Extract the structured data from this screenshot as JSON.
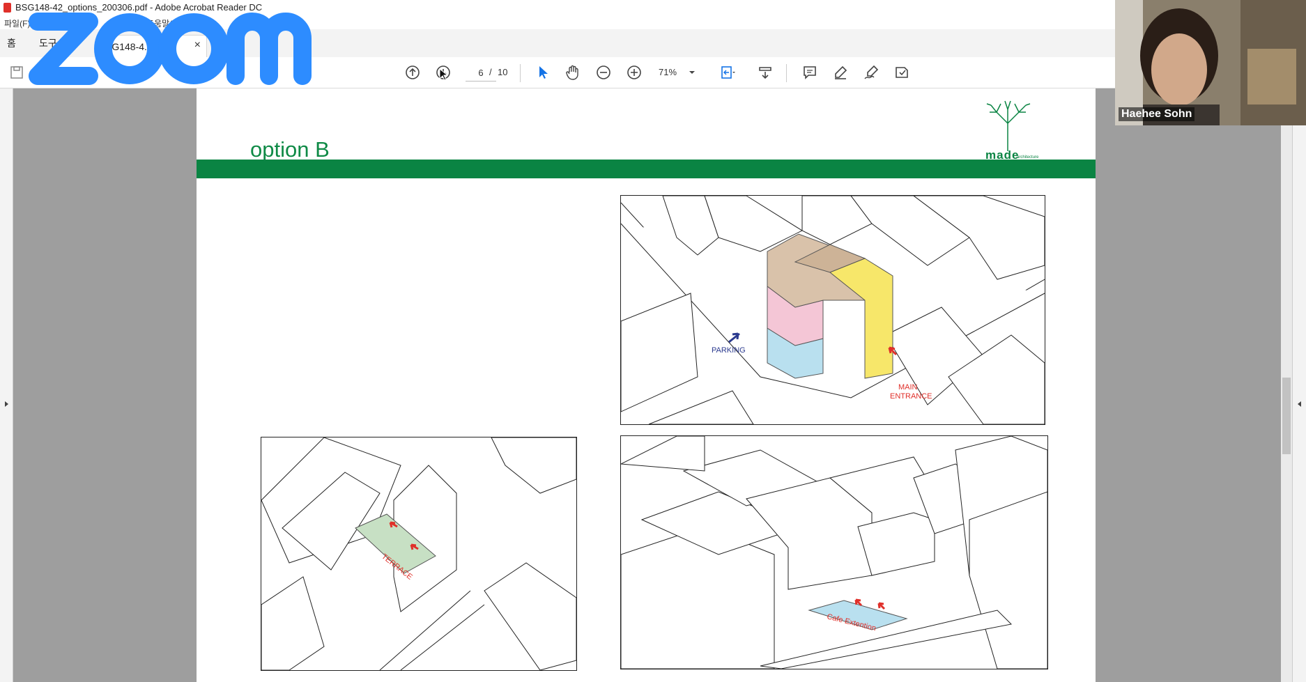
{
  "window": {
    "title": "BSG148-42_options_200306.pdf - Adobe Acrobat Reader DC"
  },
  "menu": {
    "items": [
      "파일(F)",
      "기(V)",
      "도움말("
    ]
  },
  "tabs": {
    "home": "홈",
    "tools": "도구",
    "document": "SG148-4...on...",
    "close": "×"
  },
  "toolbar": {
    "page_current": "6",
    "page_sep": "/",
    "page_total": "10",
    "zoom": "71%"
  },
  "page": {
    "title": "option B",
    "logo_word": "made",
    "logo_sub": "architecture"
  },
  "diagram_main": {
    "parking": "PARKING",
    "main_entrance_1": "MAIN",
    "main_entrance_2": "ENTRANCE"
  },
  "diagram_terrace": {
    "terrace": "TERRACE"
  },
  "diagram_cafe": {
    "cafe": "Cafe Extention"
  },
  "webcam": {
    "name": "Haehee Sohn"
  },
  "colors": {
    "accent_green": "#0a8443",
    "zoom_blue": "#2d8cff",
    "tan": "#d9c2aa",
    "pink": "#f4c6d6",
    "yellow": "#f7e76a",
    "lightblue": "#b9e0ef",
    "terrace_green": "#c7e0c4",
    "arrow_red": "#e0302a"
  }
}
